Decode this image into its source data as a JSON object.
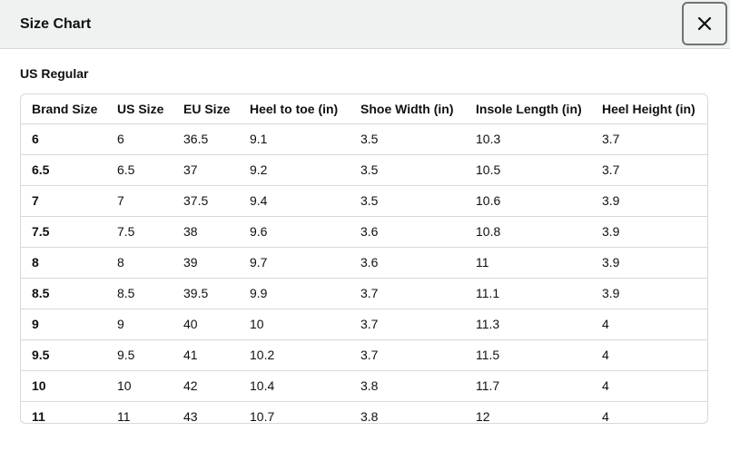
{
  "header": {
    "title": "Size Chart",
    "close_icon": "close-icon"
  },
  "section": {
    "title": "US Regular"
  },
  "table": {
    "columns": [
      "Brand Size",
      "US Size",
      "EU Size",
      "Heel to toe (in)",
      "Shoe Width (in)",
      "Insole Length (in)",
      "Heel Height (in)"
    ],
    "rows": [
      [
        "6",
        "6",
        "36.5",
        "9.1",
        "3.5",
        "10.3",
        "3.7"
      ],
      [
        "6.5",
        "6.5",
        "37",
        "9.2",
        "3.5",
        "10.5",
        "3.7"
      ],
      [
        "7",
        "7",
        "37.5",
        "9.4",
        "3.5",
        "10.6",
        "3.9"
      ],
      [
        "7.5",
        "7.5",
        "38",
        "9.6",
        "3.6",
        "10.8",
        "3.9"
      ],
      [
        "8",
        "8",
        "39",
        "9.7",
        "3.6",
        "11",
        "3.9"
      ],
      [
        "8.5",
        "8.5",
        "39.5",
        "9.9",
        "3.7",
        "11.1",
        "3.9"
      ],
      [
        "9",
        "9",
        "40",
        "10",
        "3.7",
        "11.3",
        "4"
      ],
      [
        "9.5",
        "9.5",
        "41",
        "10.2",
        "3.7",
        "11.5",
        "4"
      ],
      [
        "10",
        "10",
        "42",
        "10.4",
        "3.8",
        "11.7",
        "4"
      ],
      [
        "11",
        "11",
        "43",
        "10.7",
        "3.8",
        "12",
        "4"
      ]
    ]
  },
  "colors": {
    "header_bg": "#f0f2f2",
    "border": "#d5d9d9",
    "text": "#0f1111"
  }
}
